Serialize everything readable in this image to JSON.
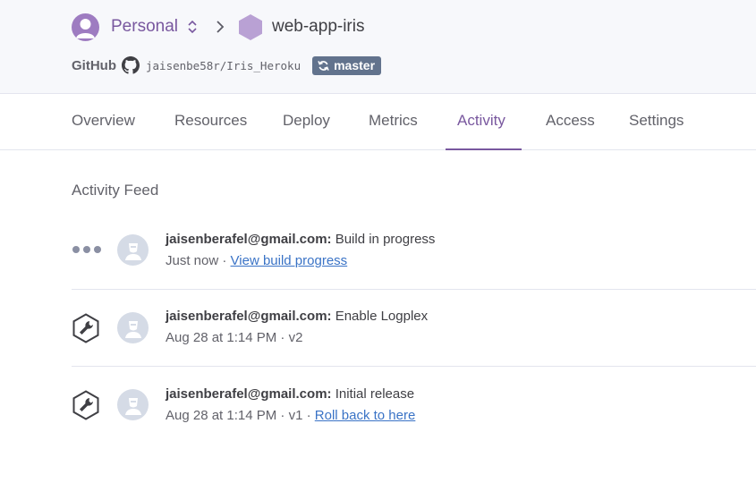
{
  "header": {
    "account": "Personal",
    "app_name": "web-app-iris",
    "github_label": "GitHub",
    "repo": "jaisenbe58r/Iris_Heroku",
    "branch": "master"
  },
  "tabs": [
    {
      "label": "Overview"
    },
    {
      "label": "Resources"
    },
    {
      "label": "Deploy"
    },
    {
      "label": "Metrics"
    },
    {
      "label": "Activity"
    },
    {
      "label": "Access"
    },
    {
      "label": "Settings"
    }
  ],
  "active_tab": "Activity",
  "feed": {
    "title": "Activity Feed",
    "items": [
      {
        "icon": "dots-progress-icon",
        "email": "jaisenberafel@gmail.com:",
        "message": "Build in progress",
        "meta": "Just now · ",
        "link": "View build progress"
      },
      {
        "icon": "wrench-icon",
        "email": "jaisenberafel@gmail.com:",
        "message": "Enable Logplex",
        "meta": "Aug 28 at 1:14 PM · v2",
        "link": ""
      },
      {
        "icon": "wrench-icon",
        "email": "jaisenberafel@gmail.com:",
        "message": "Initial release",
        "meta": "Aug 28 at 1:14 PM · v1 · ",
        "link": "Roll back to here"
      }
    ]
  },
  "colors": {
    "accent": "#79589f",
    "link": "#3a73c6",
    "branch_badge": "#62738d"
  }
}
